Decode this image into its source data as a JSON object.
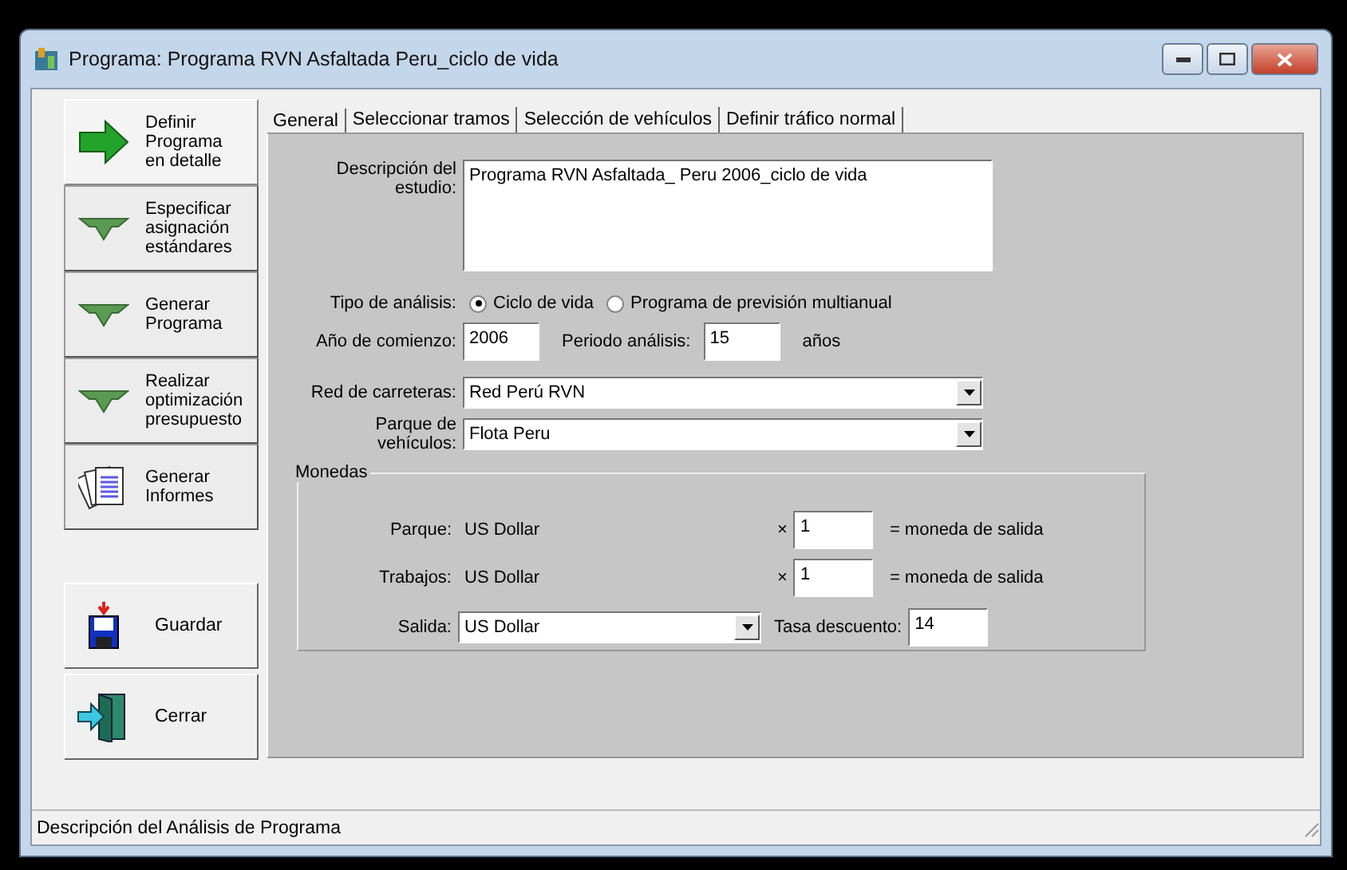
{
  "window": {
    "title": "Programa: Programa RVN Asfaltada Peru_ciclo de vida"
  },
  "steps": [
    {
      "label": "Definir\nPrograma\nen detalle",
      "kind": "arrow-right",
      "selected": true
    },
    {
      "label": "Especificar\nasignación\nestándares",
      "kind": "arrow-down",
      "selected": false
    },
    {
      "label": "Generar\nPrograma",
      "kind": "arrow-down",
      "selected": false
    },
    {
      "label": "Realizar\noptimización\npresupuesto",
      "kind": "arrow-down",
      "selected": false
    },
    {
      "label": "Generar\nInformes",
      "kind": "reports",
      "selected": false
    }
  ],
  "actions": [
    {
      "label": "Guardar",
      "kind": "save"
    },
    {
      "label": "Cerrar",
      "kind": "exit"
    }
  ],
  "tabs": [
    {
      "label": "General",
      "selected": true
    },
    {
      "label": "Seleccionar tramos",
      "selected": false
    },
    {
      "label": "Selección de vehículos",
      "selected": false
    },
    {
      "label": "Definir tráfico normal",
      "selected": false
    }
  ],
  "general": {
    "description": {
      "label": "Descripción del\nestudio:",
      "value": "Programa RVN Asfaltada_ Peru 2006_ciclo de vida"
    },
    "analysis_type": {
      "label": "Tipo de análisis:",
      "options": [
        {
          "label": "Ciclo de vida",
          "selected": true
        },
        {
          "label": "Programa de previsión multianual",
          "selected": false
        }
      ]
    },
    "start_year": {
      "label": "Año de comienzo:",
      "value": "2006"
    },
    "period": {
      "label": "Periodo análisis:",
      "value": "15",
      "unit": "años"
    },
    "road_network": {
      "label": "Red de carreteras:",
      "value": "Red Perú RVN"
    },
    "fleet": {
      "label": "Parque de\nvehículos:",
      "value": "Flota Peru"
    },
    "currencies": {
      "title": "Monedas",
      "rows": [
        {
          "label": "Parque:",
          "currency": "US Dollar",
          "times": "×",
          "factor": "1",
          "result": "= moneda de salida"
        },
        {
          "label": "Trabajos:",
          "currency": "US Dollar",
          "times": "×",
          "factor": "1",
          "result": "= moneda de salida"
        }
      ],
      "output": {
        "label": "Salida:",
        "value": "US Dollar"
      },
      "discount": {
        "label": "Tasa descuento:",
        "value": "14"
      }
    }
  },
  "status_bar": "Descripción del Análisis de Programa"
}
